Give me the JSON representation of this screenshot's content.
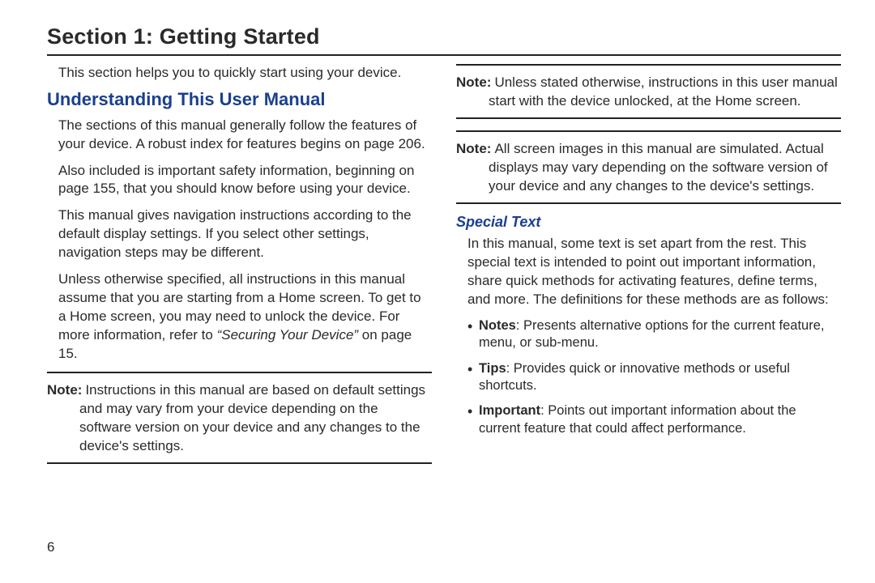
{
  "pageNumber": "6",
  "sectionTitle": "Section 1: Getting Started",
  "left": {
    "introLine": "This section helps you to quickly start using your device.",
    "heading": "Understanding This User Manual",
    "para1": "The sections of this manual generally follow the features of your device. A robust index for features begins on page 206.",
    "para2": "Also included is important safety information, beginning on page 155, that you should know before using your device.",
    "para3": "This manual gives navigation instructions according to the default display settings. If you select other settings, navigation steps may be different.",
    "para4_pre": "Unless otherwise specified, all instructions in this manual assume that you are starting from a Home screen. To get to a Home screen, you may need to unlock the device. For more information, refer to ",
    "para4_ref": "“Securing Your Device”",
    "para4_post": " on page 15.",
    "note1Label": "Note:",
    "note1Body": "Instructions in this manual are based on default settings and may vary from your device depending on the software version on your device and any changes to the device's settings."
  },
  "right": {
    "note2Label": "Note:",
    "note2Body": "Unless stated otherwise, instructions in this user manual start with the device unlocked, at the Home screen.",
    "note3Label": "Note:",
    "note3Body": "All screen images in this manual are simulated. Actual displays may vary depending on the software version of your device and any changes to the device's settings.",
    "subHeading": "Special Text",
    "para1": "In this manual, some text is set apart from the rest. This special text is intended to point out important information, share quick methods for activating features, define terms, and more. The definitions for these methods are as follows:",
    "bullets": [
      {
        "label": "Notes",
        "text": ": Presents alternative options for the current feature, menu, or sub-menu."
      },
      {
        "label": "Tips",
        "text": ": Provides quick or innovative methods or useful shortcuts."
      },
      {
        "label": "Important",
        "text": ": Points out important information about the current feature that could affect performance."
      }
    ]
  }
}
